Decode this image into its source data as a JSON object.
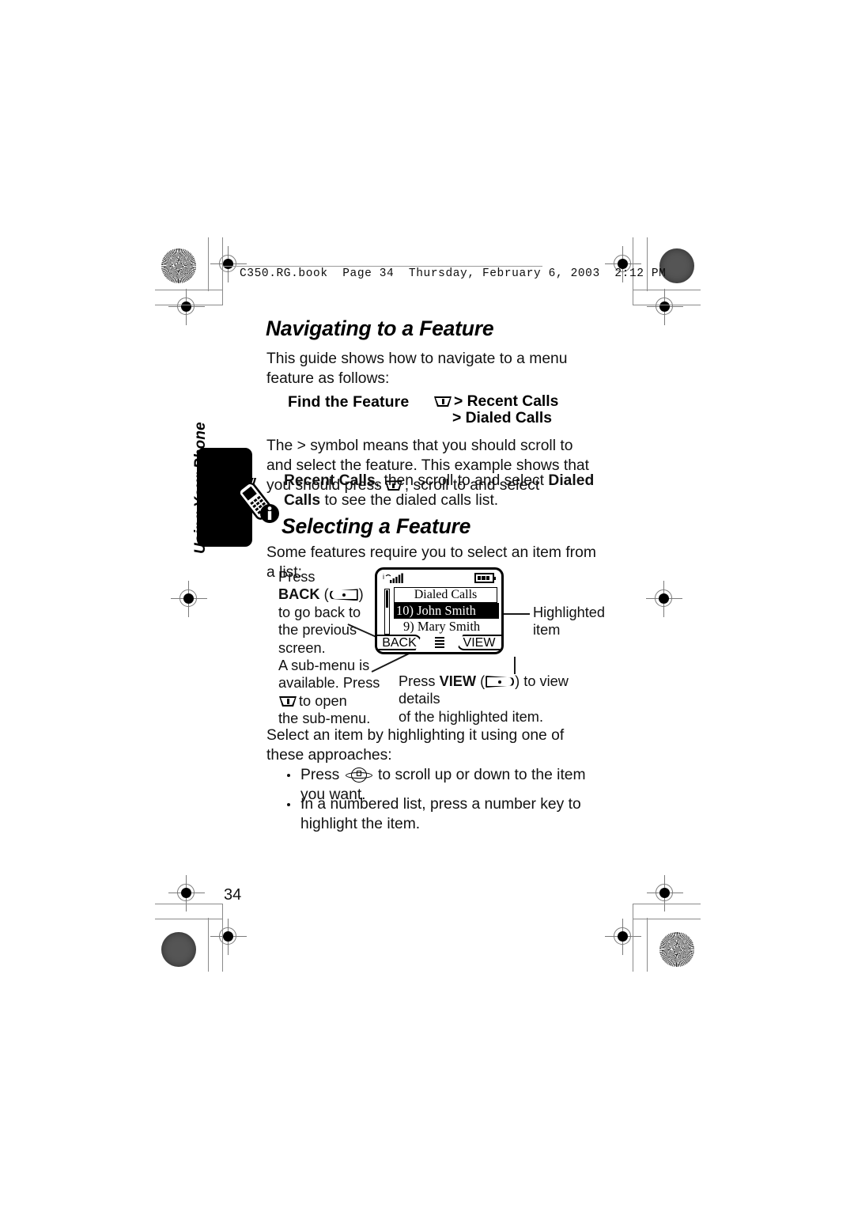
{
  "header": {
    "running_head": "C350.RG.book  Page 34  Thursday, February 6, 2003  2:12 PM"
  },
  "page_number": "34",
  "tab": {
    "label": "Using Your Phone",
    "icon": "phone-info-icon"
  },
  "sections": [
    {
      "heading": "Navigating to a Feature",
      "intro": "This guide shows how to navigate to a menu feature as follows:",
      "find_the_feature": {
        "label": "Find the Feature",
        "menu_icon": "menu-key-icon",
        "line1": "> Recent Calls",
        "line2": "> Dialed Calls"
      },
      "explanation": {
        "part1": "The > symbol means that you should scroll to and select the feature. This example shows that you should press",
        "icon": "menu-key-icon",
        "part2": ", scroll to and select",
        "bold1": "Recent Calls",
        "part3": ", then scroll to and select",
        "bold2": "Dialed Calls",
        "part4": "to see the dialed calls list."
      }
    },
    {
      "heading": "Selecting a Feature",
      "intro": "Some features require you to select an item from a list:",
      "callouts": {
        "back_key": {
          "line1": "Press",
          "line2_prefix": "BACK",
          "key_icon": "left-softkey-icon",
          "line3": "to go back to",
          "line4": "the previous",
          "line5": "screen."
        },
        "submenu": {
          "line1": "A sub-menu is",
          "line2": "available. Press",
          "key_icon": "menu-key-icon",
          "line3": "to open",
          "line4": "the sub-menu."
        },
        "highlighted": {
          "line1": "Highlighted",
          "line2": "item"
        },
        "view_key": {
          "prefix": "Press",
          "bold": "VIEW",
          "key_icon": "right-softkey-icon",
          "suffix": "to view details",
          "line2": "of the highlighted item."
        }
      },
      "phone_display": {
        "title": "Dialed Calls",
        "items": [
          {
            "text": "10) John Smith",
            "highlighted": true
          },
          {
            "text": "9) Mary Smith",
            "highlighted": false
          }
        ],
        "softkey_left": "BACK",
        "softkey_right": "VIEW",
        "softkey_center_icon": "menu-list-icon",
        "status_icons": [
          "signal-strength-icon",
          "battery-icon"
        ]
      },
      "after_text": "Select an item by highlighting it using one of these approaches:",
      "bullets": [
        {
          "prefix": "Press",
          "key_icon": "nav-key-icon",
          "suffix": "to scroll up or down to the item you want."
        },
        {
          "prefix": "In a numbered list, press a number key to highlight the item.",
          "key_icon": null,
          "suffix": ""
        }
      ]
    }
  ],
  "colors": {
    "ink": "#000000",
    "paper": "#ffffff",
    "mark_grey": "#8a8a8a"
  }
}
